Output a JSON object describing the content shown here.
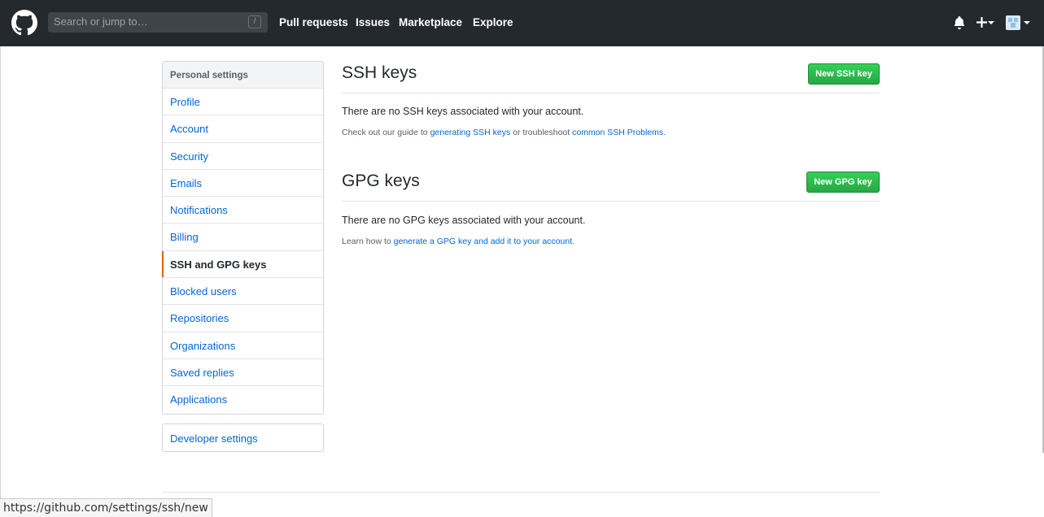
{
  "header": {
    "search_placeholder": "Search or jump to…",
    "search_shortcut": "/",
    "nav": [
      "Pull requests",
      "Issues",
      "Marketplace",
      "Explore"
    ]
  },
  "sidebar": {
    "heading": "Personal settings",
    "items": [
      "Profile",
      "Account",
      "Security",
      "Emails",
      "Notifications",
      "Billing",
      "SSH and GPG keys",
      "Blocked users",
      "Repositories",
      "Organizations",
      "Saved replies",
      "Applications"
    ],
    "selected": "SSH and GPG keys",
    "developer": "Developer settings"
  },
  "ssh": {
    "title": "SSH keys",
    "button": "New SSH key",
    "message": "There are no SSH keys associated with your account.",
    "note_prefix": "Check out our guide to ",
    "link1": "generating SSH keys",
    "note_mid": " or troubleshoot ",
    "link2": "common SSH Problems",
    "note_suffix": "."
  },
  "gpg": {
    "title": "GPG keys",
    "button": "New GPG key",
    "message": "There are no GPG keys associated with your account.",
    "note_prefix": "Learn how to ",
    "link": "generate a GPG key and add it to your account",
    "note_suffix": "."
  },
  "status_url": "https://github.com/settings/ssh/new",
  "colors": {
    "header": "#24292e",
    "link": "#0366d6",
    "accent": "#e36209",
    "button": "#28a745"
  }
}
